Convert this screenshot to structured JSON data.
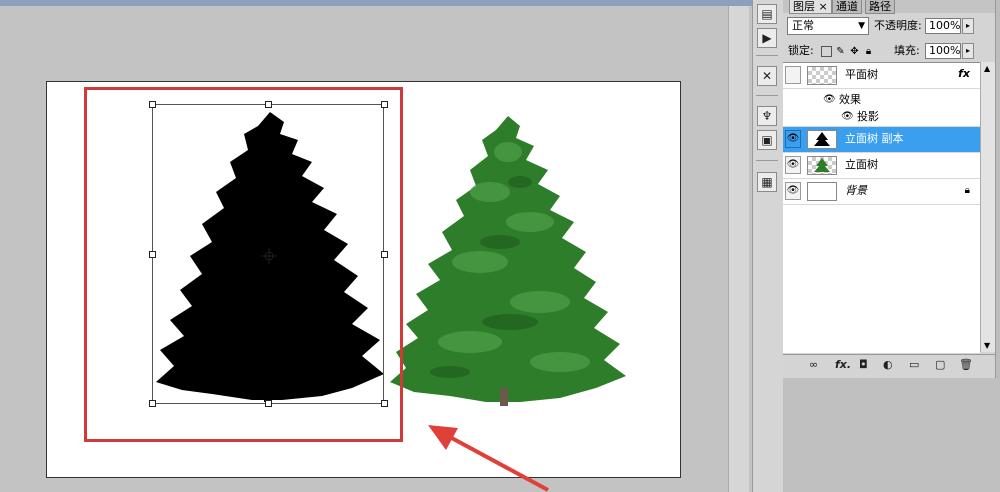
{
  "layers_panel": {
    "tabs": [
      {
        "label": "图层",
        "active": true,
        "close": "×"
      },
      {
        "label": "通道",
        "active": false
      },
      {
        "label": "路径",
        "active": false
      }
    ],
    "blend_mode": "正常",
    "opacity_label": "不透明度:",
    "opacity_value": "100%",
    "lock_label": "锁定:",
    "fill_label": "填充:",
    "fill_value": "100%",
    "layers": [
      {
        "name": "平面树",
        "visible": false,
        "thumb": "transparent",
        "fx": "fx",
        "selected": false,
        "effects_label": "效果",
        "effect_items": [
          "投影"
        ]
      },
      {
        "name": "立面树 副本",
        "visible": true,
        "thumb": "black-tree",
        "selected": true
      },
      {
        "name": "立面树",
        "visible": true,
        "thumb": "green-tree",
        "selected": false
      },
      {
        "name": "背景",
        "visible": true,
        "thumb": "white",
        "selected": false,
        "locked": true
      }
    ],
    "bottom_icons": [
      "link-icon",
      "fx-icon",
      "mask-icon",
      "adjustment-icon",
      "group-icon",
      "new-layer-icon",
      "trash-icon"
    ],
    "fx_text": "fx."
  },
  "canvas": {
    "selection_color": "#cf3b3b",
    "selected_layer_color": "#3b9ff0"
  }
}
